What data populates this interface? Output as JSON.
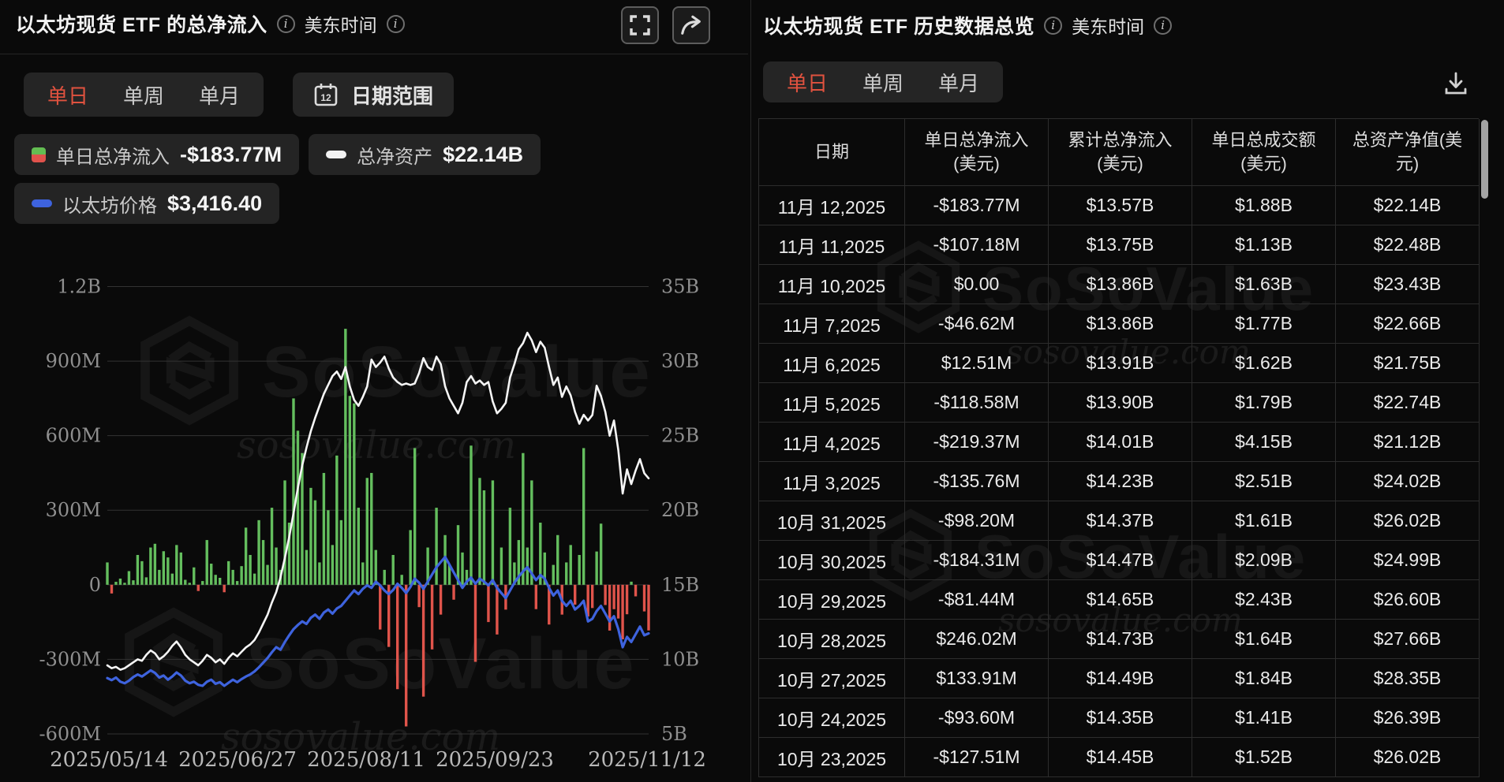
{
  "left_panel": {
    "title": "以太坊现货 ETF 的总净流入",
    "timezone_label": "美东时间",
    "tabs": [
      {
        "label": "单日",
        "active": true
      },
      {
        "label": "单周",
        "active": false
      },
      {
        "label": "单月",
        "active": false
      }
    ],
    "date_range_button": "日期范围",
    "calendar_icon_day": "12",
    "legend": [
      {
        "icon": "green-red-split",
        "label": "单日总净流入",
        "value": "-$183.77M"
      },
      {
        "icon": "white-dash",
        "label": "总净资产",
        "value": "$22.14B"
      },
      {
        "icon": "blue-dash",
        "label": "以太坊价格",
        "value": "$3,416.40"
      }
    ]
  },
  "watermark": {
    "brand": "SoSoValue",
    "domain": "sosovalue.com"
  },
  "chart_data": {
    "type": "combo-bar-line",
    "left_axis_ticks": [
      "1.2B",
      "900M",
      "600M",
      "300M",
      "0",
      "-300M",
      "-600M"
    ],
    "right_axis_ticks": [
      "35B",
      "30B",
      "25B",
      "20B",
      "15B",
      "10B",
      "5B"
    ],
    "left_axis_range_musd": [
      -600,
      1200
    ],
    "right_axis_range_busd": [
      5,
      35
    ],
    "x_tick_labels": [
      "2025/05/14",
      "2025/06/27",
      "2025/08/11",
      "2025/09/23",
      "2025/11/12"
    ],
    "series": [
      {
        "name": "单日总净流入",
        "type": "bar",
        "unit": "$M",
        "values": [
          90,
          -35,
          12,
          25,
          8,
          55,
          18,
          120,
          95,
          30,
          150,
          165,
          60,
          135,
          110,
          45,
          160,
          130,
          20,
          8,
          70,
          -25,
          15,
          180,
          85,
          40,
          28,
          -30,
          95,
          60,
          15,
          75,
          230,
          120,
          45,
          260,
          180,
          80,
          310,
          150,
          60,
          420,
          250,
          750,
          620,
          530,
          140,
          390,
          340,
          90,
          450,
          300,
          160,
          520,
          260,
          1030,
          760,
          730,
          310,
          90,
          430,
          450,
          140,
          -180,
          60,
          -250,
          120,
          -420,
          40,
          -570,
          220,
          550,
          -90,
          -450,
          150,
          -260,
          310,
          -120,
          200,
          80,
          -60,
          240,
          130,
          60,
          560,
          -310,
          430,
          380,
          -150,
          420,
          -200,
          150,
          -100,
          310,
          90,
          180,
          530,
          150,
          420,
          -98,
          250,
          130,
          -160,
          80,
          200,
          -120,
          90,
          160,
          -80,
          120,
          550,
          -127.51,
          -93.6,
          133.91,
          246.02,
          -81.44,
          -184.31,
          -98.2,
          -135.76,
          -219.37,
          -118.58,
          12.51,
          -46.62,
          0,
          -107.18,
          -183.77
        ]
      },
      {
        "name": "总净资产",
        "type": "line",
        "unit": "$B",
        "values": [
          9.6,
          9.4,
          9.5,
          9.3,
          9.4,
          9.6,
          9.8,
          10.0,
          9.9,
          10.3,
          10.6,
          10.4,
          10.0,
          10.2,
          10.5,
          10.9,
          11.2,
          10.8,
          10.3,
          10.0,
          9.8,
          9.6,
          9.9,
          10.3,
          10.1,
          9.8,
          10.0,
          9.7,
          10.1,
          10.4,
          10.2,
          10.5,
          10.8,
          11.0,
          11.3,
          11.8,
          12.4,
          13.0,
          13.8,
          14.5,
          15.5,
          16.8,
          18.2,
          19.8,
          21.5,
          23.0,
          24.2,
          25.3,
          26.2,
          27.0,
          27.8,
          28.4,
          29.0,
          29.3,
          28.8,
          29.6,
          28.3,
          27.4,
          27.0,
          27.6,
          28.3,
          30.1,
          29.6,
          29.9,
          30.3,
          29.5,
          28.9,
          28.6,
          28.4,
          28.5,
          28.4,
          28.5,
          29.2,
          30.2,
          29.6,
          29.4,
          30.3,
          29.8,
          28.3,
          27.5,
          27.0,
          26.5,
          27.2,
          28.6,
          29.0,
          28.5,
          28.7,
          28.4,
          28.6,
          27.3,
          26.5,
          26.8,
          27.2,
          28.9,
          29.8,
          30.8,
          31.2,
          31.9,
          31.4,
          30.6,
          31.3,
          30.9,
          29.6,
          28.4,
          28.9,
          27.6,
          28.3,
          27.7,
          26.6,
          25.8,
          26.4,
          26.02,
          26.39,
          28.35,
          27.66,
          26.6,
          24.99,
          26.02,
          24.02,
          21.12,
          22.74,
          21.75,
          22.66,
          23.43,
          22.48,
          22.14
        ]
      },
      {
        "name": "以太坊价格",
        "type": "line",
        "unit": "$",
        "values": [
          2550,
          2510,
          2560,
          2480,
          2450,
          2500,
          2570,
          2620,
          2580,
          2640,
          2700,
          2650,
          2560,
          2600,
          2520,
          2580,
          2660,
          2600,
          2500,
          2450,
          2480,
          2420,
          2400,
          2480,
          2520,
          2440,
          2470,
          2400,
          2460,
          2520,
          2470,
          2530,
          2580,
          2620,
          2680,
          2760,
          2850,
          2940,
          3050,
          3150,
          3100,
          3250,
          3380,
          3500,
          3580,
          3650,
          3600,
          3720,
          3780,
          3700,
          3820,
          3880,
          3800,
          3900,
          3950,
          4050,
          4150,
          4250,
          4180,
          4280,
          4350,
          4300,
          4420,
          4350,
          4250,
          4180,
          4260,
          4380,
          4300,
          4200,
          4320,
          4480,
          4400,
          4280,
          4420,
          4560,
          4700,
          4800,
          4900,
          4750,
          4600,
          4450,
          4300,
          4420,
          4500,
          4380,
          4480,
          4420,
          4350,
          4450,
          4300,
          4200,
          4100,
          4250,
          4400,
          4520,
          4620,
          4700,
          4580,
          4450,
          4550,
          4480,
          4300,
          4150,
          4250,
          4050,
          3950,
          4050,
          3880,
          3950,
          4050,
          3650,
          3700,
          3850,
          3950,
          3800,
          3650,
          3750,
          3500,
          3150,
          3350,
          3250,
          3400,
          3550,
          3380,
          3416.4
        ]
      }
    ],
    "colors": {
      "positive": "#64be5e",
      "negative": "#e0544b",
      "nav_line": "#f5f5f5",
      "price_line": "#3e63de",
      "grid": "#333333",
      "axis_text": "#8f8f8f",
      "x_text": "#b8b8b8",
      "accent": "#e0523f"
    }
  },
  "right_panel": {
    "title": "以太坊现货 ETF 历史数据总览",
    "timezone_label": "美东时间",
    "tabs": [
      {
        "label": "单日",
        "active": true
      },
      {
        "label": "单周",
        "active": false
      },
      {
        "label": "单月",
        "active": false
      }
    ],
    "table": {
      "columns": [
        {
          "l1": "日期",
          "l2": ""
        },
        {
          "l1": "单日总净流入",
          "l2": "(美元)"
        },
        {
          "l1": "累计总净流入",
          "l2": "(美元)"
        },
        {
          "l1": "单日总成交额",
          "l2": "(美元)"
        },
        {
          "l1": "总资产净值(美",
          "l2": "元)"
        }
      ],
      "rows": [
        {
          "date": "11月 12,2025",
          "inflow": "-$183.77M",
          "tone": "neg",
          "cumulative": "$13.57B",
          "volume": "$1.88B",
          "nav": "$22.14B"
        },
        {
          "date": "11月 11,2025",
          "inflow": "-$107.18M",
          "tone": "neg",
          "cumulative": "$13.75B",
          "volume": "$1.13B",
          "nav": "$22.48B"
        },
        {
          "date": "11月 10,2025",
          "inflow": "$0.00",
          "tone": "zero",
          "cumulative": "$13.86B",
          "volume": "$1.63B",
          "nav": "$23.43B"
        },
        {
          "date": "11月 7,2025",
          "inflow": "-$46.62M",
          "tone": "neg",
          "cumulative": "$13.86B",
          "volume": "$1.77B",
          "nav": "$22.66B"
        },
        {
          "date": "11月 6,2025",
          "inflow": "$12.51M",
          "tone": "pos",
          "cumulative": "$13.91B",
          "volume": "$1.62B",
          "nav": "$21.75B"
        },
        {
          "date": "11月 5,2025",
          "inflow": "-$118.58M",
          "tone": "neg",
          "cumulative": "$13.90B",
          "volume": "$1.79B",
          "nav": "$22.74B"
        },
        {
          "date": "11月 4,2025",
          "inflow": "-$219.37M",
          "tone": "neg",
          "cumulative": "$14.01B",
          "volume": "$4.15B",
          "nav": "$21.12B"
        },
        {
          "date": "11月 3,2025",
          "inflow": "-$135.76M",
          "tone": "neg",
          "cumulative": "$14.23B",
          "volume": "$2.51B",
          "nav": "$24.02B"
        },
        {
          "date": "10月 31,2025",
          "inflow": "-$98.20M",
          "tone": "neg",
          "cumulative": "$14.37B",
          "volume": "$1.61B",
          "nav": "$26.02B"
        },
        {
          "date": "10月 30,2025",
          "inflow": "-$184.31M",
          "tone": "neg",
          "cumulative": "$14.47B",
          "volume": "$2.09B",
          "nav": "$24.99B"
        },
        {
          "date": "10月 29,2025",
          "inflow": "-$81.44M",
          "tone": "neg",
          "cumulative": "$14.65B",
          "volume": "$2.43B",
          "nav": "$26.60B"
        },
        {
          "date": "10月 28,2025",
          "inflow": "$246.02M",
          "tone": "pos",
          "cumulative": "$14.73B",
          "volume": "$1.64B",
          "nav": "$27.66B"
        },
        {
          "date": "10月 27,2025",
          "inflow": "$133.91M",
          "tone": "pos",
          "cumulative": "$14.49B",
          "volume": "$1.84B",
          "nav": "$28.35B"
        },
        {
          "date": "10月 24,2025",
          "inflow": "-$93.60M",
          "tone": "neg",
          "cumulative": "$14.35B",
          "volume": "$1.41B",
          "nav": "$26.39B"
        },
        {
          "date": "10月 23,2025",
          "inflow": "-$127.51M",
          "tone": "neg",
          "cumulative": "$14.45B",
          "volume": "$1.52B",
          "nav": "$26.02B"
        }
      ]
    }
  }
}
